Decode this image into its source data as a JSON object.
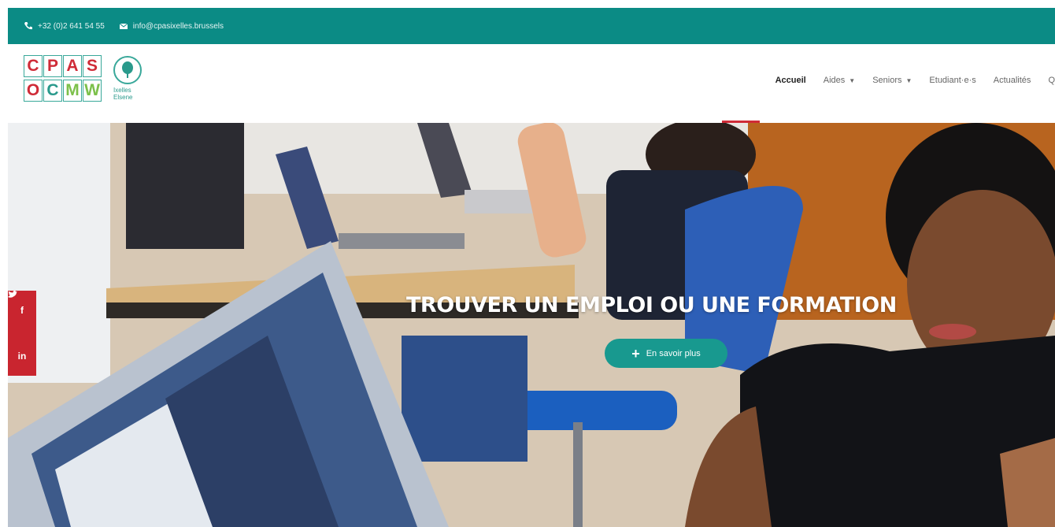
{
  "topbar": {
    "phone": "+32 (0)2 641 54 55",
    "email": "info@cpasixelles.brussels",
    "phone_icon": "phone-icon",
    "email_icon": "envelope-icon",
    "bg_color": "#0b8b85"
  },
  "logo": {
    "letters_top": [
      "C",
      "P",
      "A",
      "S"
    ],
    "letters_bottom": [
      "O",
      "C",
      "M",
      "W"
    ],
    "subtitle_line1": "Ixelles",
    "subtitle_line2": "Elsene",
    "icon": "tree-icon"
  },
  "nav": {
    "items": [
      {
        "label": "Accueil",
        "active": true,
        "dropdown": false
      },
      {
        "label": "Aides",
        "active": false,
        "dropdown": true
      },
      {
        "label": "Seniors",
        "active": false,
        "dropdown": true
      },
      {
        "label": "Etudiant·e·s",
        "active": false,
        "dropdown": false
      },
      {
        "label": "Actualités",
        "active": false,
        "dropdown": false
      },
      {
        "label": "Q",
        "active": false,
        "dropdown": false
      }
    ],
    "active_color": "#cf2b37"
  },
  "hero": {
    "title": "TROUVER UN EMPLOI OU UNE FORMATION",
    "cta_label": "En savoir plus",
    "cta_icon": "plus-icon",
    "cta_color": "#18998f"
  },
  "social": {
    "items": [
      {
        "icon": "facebook-icon",
        "glyph": "f"
      },
      {
        "icon": "twitter-icon",
        "glyph": "🐦"
      },
      {
        "icon": "linkedin-icon",
        "glyph": "in"
      }
    ],
    "bg_color": "#c9252f"
  }
}
